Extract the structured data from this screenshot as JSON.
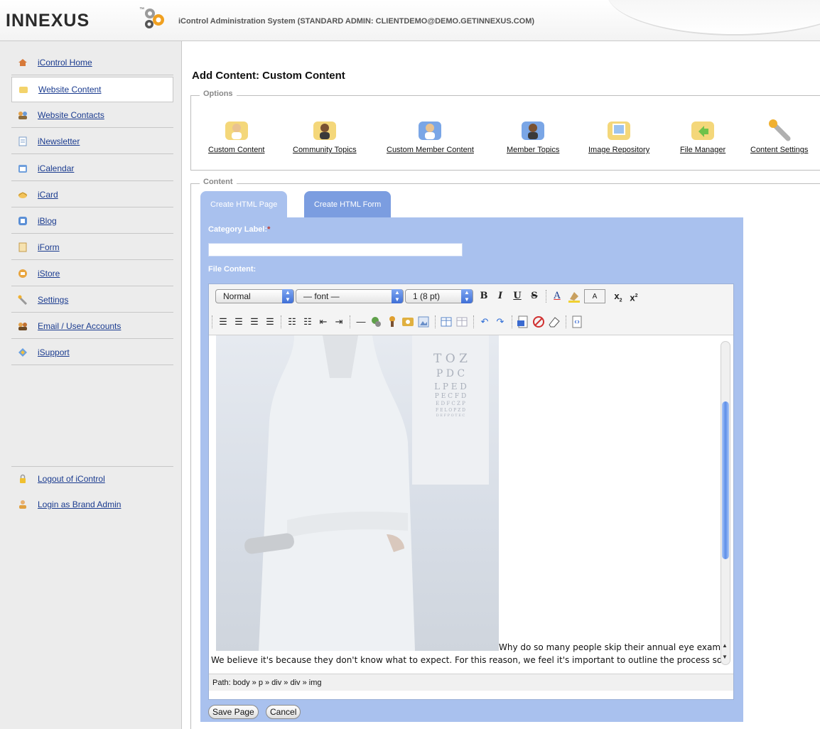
{
  "header": {
    "logo_text": "INNEXUS",
    "logo_tm": "™",
    "title": "iControl Administration System (STANDARD ADMIN: CLIENTDEMO@DEMO.GETINNEXUS.COM)"
  },
  "sidebar": {
    "items": [
      {
        "label": "iControl Home",
        "icon": "home-icon"
      },
      {
        "label": "Website Content",
        "icon": "folder-icon"
      },
      {
        "label": "Website Contacts",
        "icon": "contacts-icon"
      },
      {
        "label": "iNewsletter",
        "icon": "newsletter-icon"
      },
      {
        "label": "iCalendar",
        "icon": "calendar-icon"
      },
      {
        "label": "iCard",
        "icon": "card-icon"
      },
      {
        "label": "iBlog",
        "icon": "blog-icon"
      },
      {
        "label": "iForm",
        "icon": "form-icon"
      },
      {
        "label": "iStore",
        "icon": "store-icon"
      },
      {
        "label": "Settings",
        "icon": "wrench-icon"
      },
      {
        "label": "Email / User Accounts",
        "icon": "users-icon"
      },
      {
        "label": "iSupport",
        "icon": "support-icon"
      }
    ],
    "bottom_items": [
      {
        "label": "Logout of iControl",
        "icon": "lock-icon"
      },
      {
        "label": "Login as Brand Admin",
        "icon": "user-icon"
      }
    ],
    "active_index": 1
  },
  "page": {
    "title": "Add Content: Custom Content",
    "options_legend": "Options",
    "content_legend": "Content"
  },
  "options": [
    {
      "label": "Custom Content"
    },
    {
      "label": "Community Topics"
    },
    {
      "label": "Custom Member Content"
    },
    {
      "label": "Member Topics"
    },
    {
      "label": "Image Repository"
    },
    {
      "label": "File Manager"
    },
    {
      "label": "Content Settings"
    }
  ],
  "tabs": {
    "page": "Create HTML Page",
    "form": "Create HTML Form"
  },
  "form": {
    "category_label": "Category Label:",
    "required_mark": "*",
    "category_value": "",
    "file_content_label": "File Content:"
  },
  "editor": {
    "format_select": "Normal",
    "font_select": "— font —",
    "size_select": "1 (8 pt)",
    "toolbar": {
      "bold": "B",
      "italic": "I",
      "underline": "U",
      "strike": "S",
      "fontcolor": "A",
      "bgcolor_label": "A",
      "sub": "x",
      "sup": "x"
    },
    "chart_letters": [
      "T O Z",
      "P D C",
      "L P E D",
      "P E C F D",
      "E D F C Z P",
      "F E L O P Z D",
      "D E F P O T E C"
    ],
    "text_line1": "Why do so many people skip their annual eye exam?",
    "text_line2": "We believe it's because they don't know what to expect. For this reason, we feel it's important to outline the process so",
    "path": "Path:  body » p » div » div » img"
  },
  "buttons": {
    "save": "Save Page",
    "cancel": "Cancel"
  },
  "colors": {
    "panel": "#a9c1ee",
    "tab_active": "#a9c1ee",
    "tab_inactive": "#7b9de0",
    "link": "#1a3b8f"
  }
}
